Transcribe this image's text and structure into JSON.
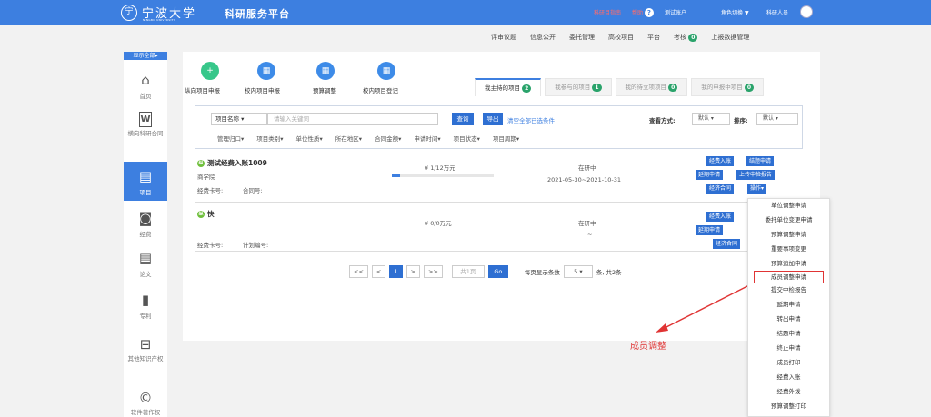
{
  "header": {
    "logo_char": "宁",
    "brand": "宁波大学",
    "brand_sub": "NINGBO UNIVERSITY",
    "platform": "科研服务平台",
    "links": [
      "科研目指南",
      "帮助",
      "测试账户"
    ],
    "role": "角色切换",
    "user": "科研人员"
  },
  "subnav": {
    "items": [
      "评审议题",
      "信息公开",
      "委托管理",
      "高校项目",
      "平台"
    ],
    "audit_label": "考核",
    "audit_count": "0",
    "report": "上报数据管理"
  },
  "sidebar": {
    "show_all": "显示全部",
    "items": [
      {
        "label": "首页",
        "icon": "home-icon"
      },
      {
        "label": "横向科研合同",
        "icon": "word-document-icon"
      },
      {
        "label": "项目",
        "icon": "document-icon"
      },
      {
        "label": "经费",
        "icon": "money-icon"
      },
      {
        "label": "论文",
        "icon": "paper-icon"
      },
      {
        "label": "专利",
        "icon": "bookmark-icon"
      },
      {
        "label": "其他知识产权",
        "icon": "disk-icon"
      },
      {
        "label": "软件著作权",
        "icon": "copyright-icon"
      }
    ]
  },
  "quick": [
    {
      "label": "纵向项目申报",
      "icon": "plus-doc-icon",
      "color": "#37c78a"
    },
    {
      "label": "校内项目申报",
      "icon": "form-icon",
      "color": "#3d8be8"
    },
    {
      "label": "预算调整",
      "icon": "form-icon",
      "color": "#3d8be8"
    },
    {
      "label": "校内项目登记",
      "icon": "form-icon",
      "color": "#3d8be8"
    }
  ],
  "tabs": [
    {
      "label": "我主持的项目",
      "count": "2"
    },
    {
      "label": "我参与的项目",
      "count": "1"
    },
    {
      "label": "我的待立项项目",
      "count": "0"
    },
    {
      "label": "我的申报中项目",
      "count": "0"
    }
  ],
  "search": {
    "field": "项目名称",
    "placeholder": "请输入关键词",
    "search_btn": "查询",
    "export_btn": "导出",
    "clear": "清空全部已选条件",
    "view_label": "查看方式:",
    "view_value": "默认",
    "sort_label": "排序:",
    "sort_value": "默认",
    "filters": [
      "管理归口",
      "项目类别",
      "单位性质",
      "所在地区",
      "合同金额",
      "申请时间",
      "项目状态",
      "项目周期"
    ]
  },
  "projects": [
    {
      "name": "测试经费入账1009",
      "dept": "商学院",
      "card_label": "经费卡号:",
      "num_label": "合同号:",
      "amount": "¥ 1/12万元",
      "progress": 0.083,
      "status": "在研中",
      "period": "2021-05-30~2021-10-31",
      "actions": [
        "经费入账",
        "结题申请",
        "延期申请",
        "上传中检报告",
        "经济合同",
        "操作▾"
      ]
    },
    {
      "name": "快",
      "dept": "",
      "card_label": "经费卡号:",
      "num_label": "计划编号:",
      "amount": "¥ 0/0万元",
      "progress": 0,
      "status": "在研中",
      "period": "~",
      "actions": [
        "经费入账",
        "延期申请",
        "经济合同"
      ]
    }
  ],
  "pager": {
    "first": "<<",
    "prev": "<",
    "current": "1",
    "next": ">",
    "last": ">>",
    "total_pages": "共1页",
    "go": "Go",
    "per_page_label": "每页显示条数",
    "per_page": "5",
    "suffix": "条, 共2条"
  },
  "dropdown": [
    "单位调整申请",
    "委托单位变更申请",
    "预算调整申请",
    "重要事项变更",
    "预算追加申请",
    "成员调整申请",
    "提交中检报告",
    "延期申请",
    "转出申请",
    "结题申请",
    "终止申请",
    "成员打印",
    "经费入账",
    "经费外拨",
    "预算调整打印"
  ],
  "annotation": "成员调整",
  "colors": {
    "primary": "#3d7fe0",
    "annotation": "#e03434",
    "badge": "#2aa36b"
  }
}
